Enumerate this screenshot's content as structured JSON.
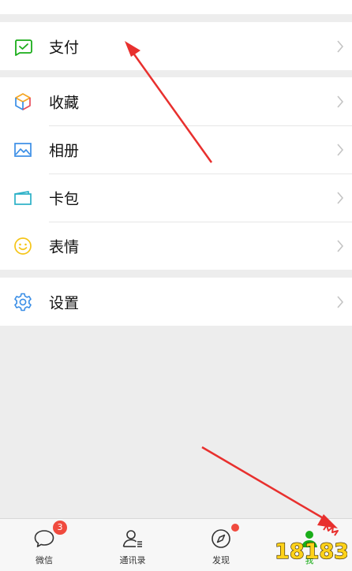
{
  "groups": [
    {
      "items": [
        {
          "icon": "wallet-pay-icon",
          "label": "支付"
        }
      ]
    },
    {
      "items": [
        {
          "icon": "favorites-cube-icon",
          "label": "收藏"
        },
        {
          "icon": "photo-album-icon",
          "label": "相册"
        },
        {
          "icon": "card-wallet-icon",
          "label": "卡包"
        },
        {
          "icon": "smiley-face-icon",
          "label": "表情"
        }
      ]
    },
    {
      "items": [
        {
          "icon": "gear-icon",
          "label": "设置"
        }
      ]
    }
  ],
  "tabs": [
    {
      "icon": "chat-bubble-icon",
      "label": "微信",
      "badge": "3"
    },
    {
      "icon": "contacts-icon",
      "label": "通讯录"
    },
    {
      "icon": "compass-icon",
      "label": "发现",
      "dot": true
    },
    {
      "icon": "person-icon",
      "label": "我",
      "active": true
    }
  ],
  "watermark": {
    "text": "18183"
  },
  "colors": {
    "accent_green": "#1aad19",
    "badge_red": "#f04a3e",
    "annotation_arrow": "#e8302e",
    "background": "#ededed"
  }
}
